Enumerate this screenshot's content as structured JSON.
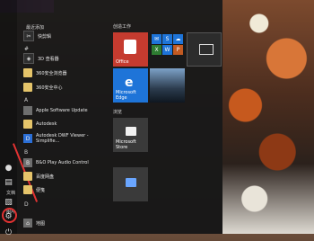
{
  "taskbar_top": {
    "label": ""
  },
  "start_menu": {
    "rail": {
      "items": [
        {
          "name": "user",
          "icon": "user-icon"
        },
        {
          "name": "docs",
          "icon": "document-icon",
          "label": "文档"
        },
        {
          "name": "pictures",
          "icon": "pictures-icon",
          "label": "图片"
        },
        {
          "name": "settings",
          "icon": "gear-icon",
          "label": ""
        },
        {
          "name": "power",
          "icon": "power-icon"
        }
      ]
    },
    "apps": {
      "recently_added_title": "最近添加",
      "recent": [
        {
          "label": "快剪辑",
          "icon": "kuaijianji-icon"
        }
      ],
      "groups": [
        {
          "letter": "#",
          "items": [
            {
              "label": "3D 查看器",
              "icon": "3d-viewer-icon"
            },
            {
              "label": "360安全浏览器",
              "icon": "folder-icon"
            },
            {
              "label": "360安全中心",
              "icon": "folder-icon"
            }
          ]
        },
        {
          "letter": "A",
          "items": [
            {
              "label": "Apple Software Update",
              "icon": "apple-update-icon"
            },
            {
              "label": "Autodesk",
              "icon": "folder-icon"
            },
            {
              "label": "Autodesk DWF Viewer - Simplifie...",
              "icon": "dwf-icon"
            }
          ]
        },
        {
          "letter": "B",
          "items": [
            {
              "label": "B&O Play Audio Control",
              "icon": "audio-icon"
            },
            {
              "label": "百度网盘",
              "icon": "folder-icon"
            },
            {
              "label": "便笺",
              "icon": "sticky-notes-icon"
            }
          ]
        },
        {
          "letter": "D",
          "items": [
            {
              "label": "地图",
              "icon": "maps-icon"
            }
          ]
        }
      ]
    },
    "tiles": {
      "group1_title": "创造工作",
      "group2_title": "浏览",
      "office_label": "Office",
      "edge_label": "Microsoft Edge",
      "photos_label": "",
      "store_label": "Microsoft Store",
      "download_label": ""
    }
  }
}
